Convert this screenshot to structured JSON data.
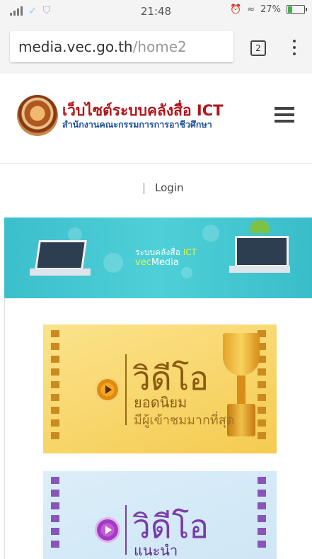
{
  "status_bar": {
    "time": "21:48",
    "battery": "27%",
    "battery_level": 0.27,
    "signal_icon": "signal-bars-icon",
    "check_icon": "check-icon",
    "shield_icon": "shield-icon",
    "alarm_icon": "alarm-clock-icon",
    "wifi_icon": "wifi-icon"
  },
  "browser": {
    "url_domain": "media.vec.go.th",
    "url_path": "/home2",
    "tab_count": "2",
    "menu_icon": "more-vert-icon"
  },
  "site": {
    "title": "เว็บไซต์ระบบคลังสื่อ ICT",
    "subtitle": "สำนักงานคณะกรรมการการอาชีวศึกษา",
    "menu_icon": "hamburger-menu-icon",
    "logo": "vec-seal-logo"
  },
  "nav": {
    "login_label": "Login"
  },
  "banner": {
    "line1": "ระบบคลังสื่อ",
    "line1_accent": "ICT",
    "line2_accent": "vec",
    "line2": "Media"
  },
  "cards": [
    {
      "title": "วิดีโอ",
      "subtitle": "ยอดนิยม",
      "caption": "มีผู้เข้าชมมากที่สุด",
      "accent": "#f5cb50"
    },
    {
      "title": "วิดีโอ",
      "subtitle": "แนะนำ",
      "accent": "#cfe6f6"
    }
  ]
}
